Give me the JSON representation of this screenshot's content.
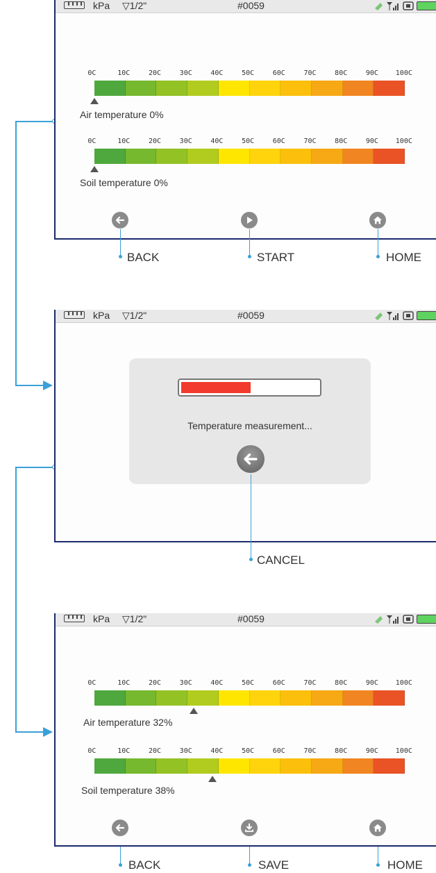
{
  "statusbar": {
    "unit": "kPa",
    "size": "1/2\"",
    "device_id": "#0059",
    "icons": [
      "ruler-icon",
      "funnel-icon",
      "satellite-icon",
      "signal-icon",
      "sd-card-icon",
      "save-icon",
      "battery-icon"
    ]
  },
  "scale": {
    "ticks": [
      "0C",
      "10C",
      "20C",
      "30C",
      "40C",
      "50C",
      "60C",
      "70C",
      "80C",
      "90C",
      "100C"
    ],
    "colors": [
      "#4fa83d",
      "#76b82e",
      "#93c225",
      "#b1cc1f",
      "#ffe600",
      "#ffd40c",
      "#fbbf0c",
      "#f7a815",
      "#f18521",
      "#e95325"
    ]
  },
  "screen1": {
    "air_label": "Air temperature 0%",
    "air_value": 0,
    "soil_label": "Soil temperature 0%",
    "soil_value": 0,
    "buttons": [
      {
        "icon": "arrow-left-icon",
        "caption": "BACK"
      },
      {
        "icon": "play-icon",
        "caption": "START"
      },
      {
        "icon": "home-icon",
        "caption": "HOME"
      }
    ]
  },
  "screen2": {
    "progress": 0.5,
    "message": "Temperature measurement...",
    "cancel_caption": "CANCEL"
  },
  "screen3": {
    "air_label": "Air temperature 32%",
    "air_value": 32,
    "soil_label": "Soil temperature 38%",
    "soil_value": 38,
    "buttons": [
      {
        "icon": "arrow-left-icon",
        "caption": "BACK"
      },
      {
        "icon": "download-icon",
        "caption": "SAVE"
      },
      {
        "icon": "home-icon",
        "caption": "HOME"
      }
    ]
  },
  "colors": {
    "accent": "#3aa0d8",
    "frame": "#1a2a6c",
    "progress_fill": "#f23a2f"
  }
}
